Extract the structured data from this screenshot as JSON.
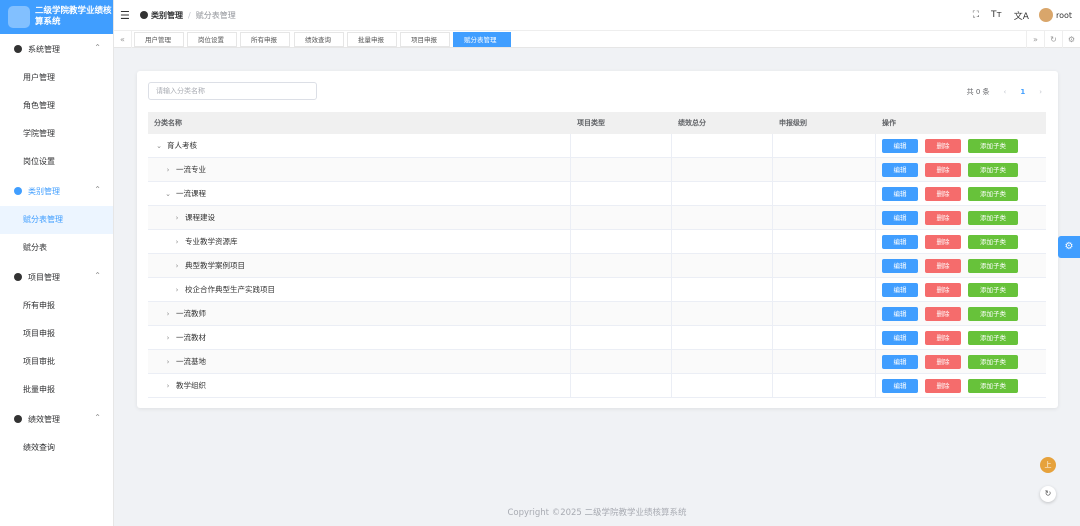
{
  "app": {
    "title": "二级学院教学业绩核算系统"
  },
  "sidebar": {
    "groups": [
      {
        "label": "系统管理",
        "items": [
          "用户管理",
          "角色管理",
          "学院管理",
          "岗位设置"
        ]
      },
      {
        "label": "类别管理",
        "items": [
          "赋分表管理",
          "赋分表"
        ]
      },
      {
        "label": "项目管理",
        "items": [
          "所有申报",
          "项目申报",
          "项目审批",
          "批量申报"
        ]
      },
      {
        "label": "绩效管理",
        "items": [
          "绩效查询"
        ]
      }
    ],
    "active_item": "赋分表管理"
  },
  "header": {
    "breadcrumb": [
      "类别管理",
      "赋分表管理"
    ],
    "icons": [
      "fullscreen-icon",
      "font-size-icon",
      "language-icon"
    ],
    "user": "root"
  },
  "tabs": [
    "用户管理",
    "岗位设置",
    "所有申报",
    "绩效查询",
    "批量申报",
    "项目申报",
    "赋分表管理"
  ],
  "active_tab": "赋分表管理",
  "search": {
    "placeholder": "请输入分类名称"
  },
  "pager": {
    "total": "共 0 条",
    "current": "1"
  },
  "table": {
    "columns": [
      "分类名称",
      "项目类型",
      "绩效总分",
      "申报级别",
      "操作"
    ],
    "rows": [
      {
        "name": "育人考核",
        "indent": 0,
        "expanded": true
      },
      {
        "name": "一流专业",
        "indent": 1,
        "expanded": false
      },
      {
        "name": "一流课程",
        "indent": 1,
        "expanded": true
      },
      {
        "name": "课程建设",
        "indent": 2,
        "expanded": false
      },
      {
        "name": "专业教学资源库",
        "indent": 2,
        "expanded": false
      },
      {
        "name": "典型教学案例项目",
        "indent": 2,
        "expanded": false
      },
      {
        "name": "校企合作典型生产实践项目",
        "indent": 2,
        "expanded": false
      },
      {
        "name": "一流教师",
        "indent": 1,
        "expanded": false
      },
      {
        "name": "一流教材",
        "indent": 1,
        "expanded": false
      },
      {
        "name": "一流基地",
        "indent": 1,
        "expanded": false
      },
      {
        "name": "教学组织",
        "indent": 1,
        "expanded": false
      }
    ],
    "actions": {
      "edit": "编辑",
      "delete": "删除",
      "add_child": "添加子类"
    }
  },
  "footer": "Copyright ©2025 二级学院教学业绩核算系统",
  "fab": {
    "user_initial": "上"
  }
}
